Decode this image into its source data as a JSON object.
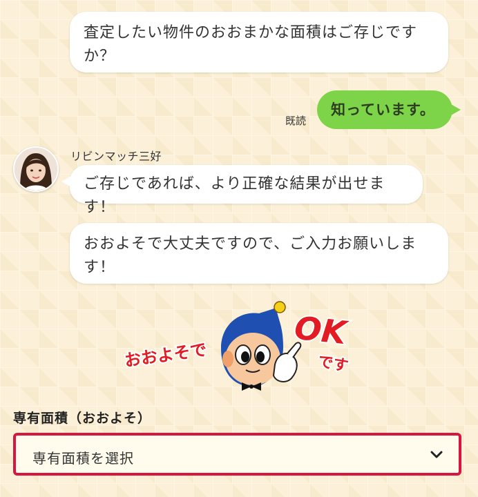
{
  "messages": {
    "q1": "査定したい物件のおおまかな面積はご存じですか？",
    "reply": "知っています。",
    "read_label": "既読",
    "sender_name": "リビンマッチ三好",
    "m2": "ご存じであれば、より正確な結果が出せます！",
    "m3": "おおよそで大丈夫ですので、ご入力お願いします！"
  },
  "mascot": {
    "left_text": "おおよそで",
    "ok_text": "OK",
    "desu_text": "です"
  },
  "form": {
    "label": "専有面積（おおよそ）",
    "select_value": "専有面積を選択"
  },
  "colors": {
    "accent_red": "#d6163e",
    "reply_green": "#7ed448",
    "background": "#fcf1d8"
  },
  "icons": {
    "select_arrow": "chevron-down-icon"
  }
}
